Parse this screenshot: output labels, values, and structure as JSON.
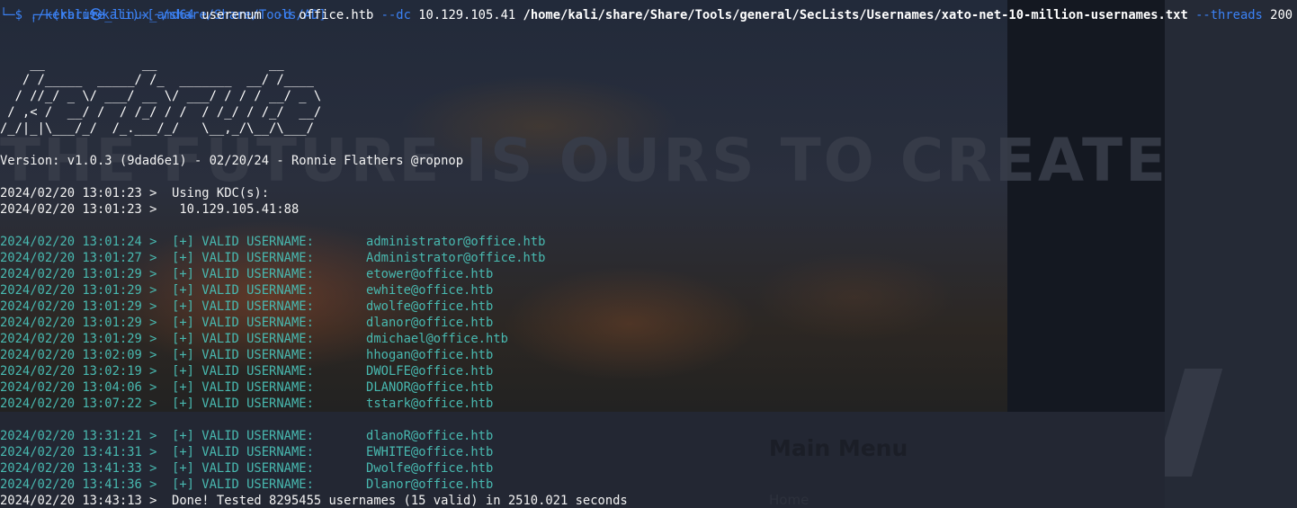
{
  "background": {
    "slogan": "THE FUTURE IS OURS TO CREATE.",
    "menu_title": "Main Menu",
    "menu_item": "Home"
  },
  "colors": {
    "terminal_text": "#f2f2f2",
    "prompt_blue": "#3b82f6",
    "success_teal": "#48b9b0"
  },
  "prompt": {
    "header": "┌──(kali㉿kali)-[~/share/Share/Tools/AD]",
    "symbol": "└─$ ",
    "command": "./kerbrute_linux_amd64",
    "subcommand": " userenum  ",
    "flag_d": "-d",
    "domain": " office.htb ",
    "flag_dc": "--dc",
    "dc_ip": " 10.129.105.41 ",
    "wordlist": "/home/kali/share/Share/Tools/general/SecLists/Usernames/xato-net-10-million-usernames.txt",
    "flag_threads": " --threads",
    "threads": " 200"
  },
  "banner": [
    "    __             __               __     ",
    "   / /_____  _____/ /_  _______  __/ /____ ",
    "  / //_/ _ \\/ ___/ __ \\/ ___/ / / / __/ _ \\",
    " / ,< /  __/ /  / /_/ / /  / /_/ / /_/  __/",
    "/_/|_|\\___/_/  /_.___/_/   \\__,_/\\__/\\___/ "
  ],
  "version_line": "Version: v1.0.3 (9dad6e1) - 02/20/24 - Ronnie Flathers @ropnop",
  "kdc_lines": [
    "2024/02/20 13:01:23 >  Using KDC(s):",
    "2024/02/20 13:01:23 >   10.129.105.41:88"
  ],
  "valid_label": "[+] VALID USERNAME:",
  "results_group1": [
    {
      "ts": "2024/02/20 13:01:24 >  ",
      "user": "administrator@office.htb"
    },
    {
      "ts": "2024/02/20 13:01:27 >  ",
      "user": "Administrator@office.htb"
    },
    {
      "ts": "2024/02/20 13:01:29 >  ",
      "user": "etower@office.htb"
    },
    {
      "ts": "2024/02/20 13:01:29 >  ",
      "user": "ewhite@office.htb"
    },
    {
      "ts": "2024/02/20 13:01:29 >  ",
      "user": "dwolfe@office.htb"
    },
    {
      "ts": "2024/02/20 13:01:29 >  ",
      "user": "dlanor@office.htb"
    },
    {
      "ts": "2024/02/20 13:01:29 >  ",
      "user": "dmichael@office.htb"
    },
    {
      "ts": "2024/02/20 13:02:09 >  ",
      "user": "hhogan@office.htb"
    },
    {
      "ts": "2024/02/20 13:02:19 >  ",
      "user": "DWOLFE@office.htb"
    },
    {
      "ts": "2024/02/20 13:04:06 >  ",
      "user": "DLANOR@office.htb"
    },
    {
      "ts": "2024/02/20 13:07:22 >  ",
      "user": "tstark@office.htb"
    }
  ],
  "results_group2": [
    {
      "ts": "2024/02/20 13:31:21 >  ",
      "user": "dlanoR@office.htb"
    },
    {
      "ts": "2024/02/20 13:41:31 >  ",
      "user": "EWHITE@office.htb"
    },
    {
      "ts": "2024/02/20 13:41:33 >  ",
      "user": "Dwolfe@office.htb"
    },
    {
      "ts": "2024/02/20 13:41:36 >  ",
      "user": "Dlanor@office.htb"
    }
  ],
  "done_line": "2024/02/20 13:43:13 >  Done! Tested 8295455 usernames (15 valid) in 2510.021 seconds"
}
